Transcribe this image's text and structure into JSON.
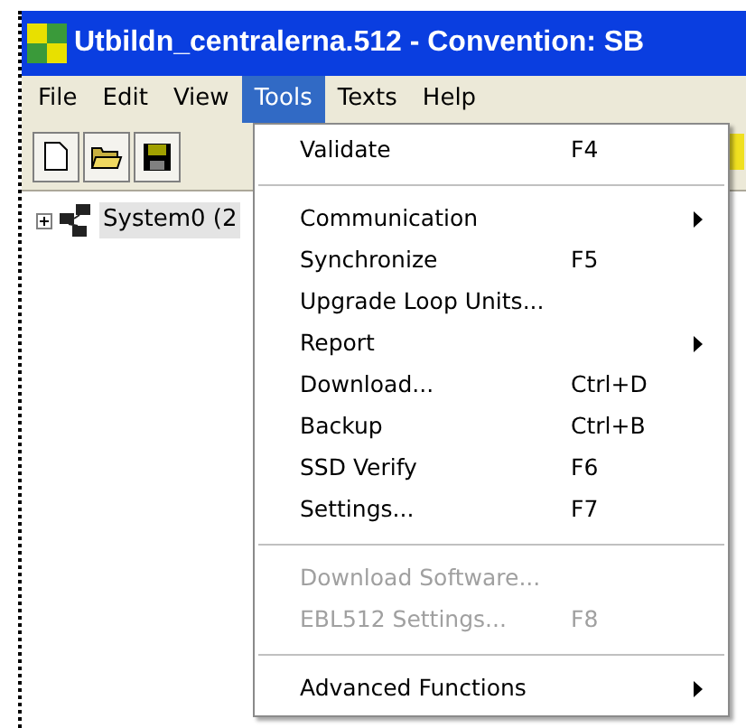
{
  "window": {
    "title": "Utbildn_centralerna.512 - Convention: SB"
  },
  "menu_bar": [
    {
      "label": "File",
      "selected": false
    },
    {
      "label": "Edit",
      "selected": false
    },
    {
      "label": "View",
      "selected": false
    },
    {
      "label": "Tools",
      "selected": true
    },
    {
      "label": "Texts",
      "selected": false
    },
    {
      "label": "Help",
      "selected": false
    }
  ],
  "tree": [
    {
      "label": "System0 (2",
      "expanded": false
    }
  ],
  "tools_menu": [
    {
      "kind": "item",
      "label": "Validate",
      "shortcut": "F4",
      "submenu": false,
      "disabled": false
    },
    {
      "kind": "separator"
    },
    {
      "kind": "item",
      "label": "Communication",
      "submenu": true,
      "disabled": false
    },
    {
      "kind": "item",
      "label": "Synchronize",
      "shortcut": "F5",
      "submenu": false,
      "disabled": false
    },
    {
      "kind": "item",
      "label": "Upgrade Loop Units...",
      "submenu": false,
      "disabled": false
    },
    {
      "kind": "item",
      "label": "Report",
      "submenu": true,
      "disabled": false
    },
    {
      "kind": "item",
      "label": "Download...",
      "shortcut": "Ctrl+D",
      "submenu": false,
      "disabled": false
    },
    {
      "kind": "item",
      "label": "Backup",
      "shortcut": "Ctrl+B",
      "submenu": false,
      "disabled": false
    },
    {
      "kind": "item",
      "label": "SSD Verify",
      "shortcut": "F6",
      "submenu": false,
      "disabled": false
    },
    {
      "kind": "item",
      "label": "Settings...",
      "shortcut": "F7",
      "submenu": false,
      "disabled": false
    },
    {
      "kind": "separator"
    },
    {
      "kind": "item",
      "label": "Download Software...",
      "submenu": false,
      "disabled": true
    },
    {
      "kind": "item",
      "label": "EBL512 Settings...",
      "shortcut": "F8",
      "submenu": false,
      "disabled": true
    },
    {
      "kind": "separator"
    },
    {
      "kind": "item",
      "label": "Advanced Functions",
      "submenu": true,
      "disabled": false
    }
  ]
}
